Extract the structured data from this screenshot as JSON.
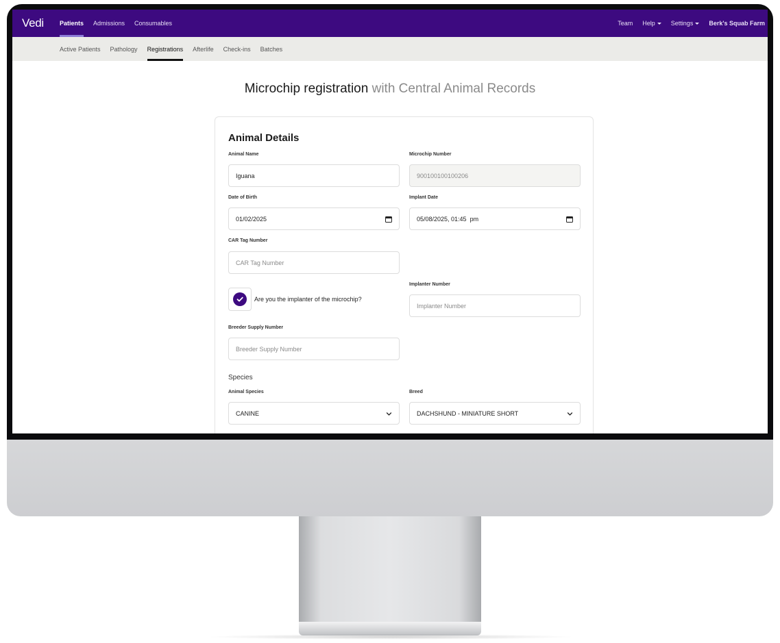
{
  "app": {
    "brand": "Vedi"
  },
  "topnav": {
    "items": [
      {
        "label": "Patients"
      },
      {
        "label": "Admissions"
      },
      {
        "label": "Consumables"
      }
    ],
    "right": [
      {
        "label": "Team"
      },
      {
        "label": "Help"
      },
      {
        "label": "Settings"
      }
    ],
    "farm": "Berk's Squab Farm"
  },
  "subnav": {
    "items": [
      {
        "label": "Active Patients"
      },
      {
        "label": "Pathology"
      },
      {
        "label": "Registrations"
      },
      {
        "label": "Afterlife"
      },
      {
        "label": "Check-ins"
      },
      {
        "label": "Batches"
      }
    ]
  },
  "page": {
    "title": "Microchip registration",
    "title_suffix": "with Central Animal Records"
  },
  "form": {
    "heading": "Animal Details",
    "animal_name": {
      "label": "Animal Name",
      "value": "Iguana"
    },
    "microchip": {
      "label": "Microchip Number",
      "value": "900100100100206"
    },
    "dob": {
      "label": "Date of Birth",
      "value": "01/02/2025"
    },
    "implant_date": {
      "label": "Implant Date",
      "value": "05/08/2025, 01:45  pm"
    },
    "car_tag": {
      "label": "CAR Tag Number",
      "placeholder": "CAR Tag Number"
    },
    "implanter_question": "Are you the implanter of the microchip?",
    "implanter_number": {
      "label": "Implanter Number",
      "placeholder": "Implanter Number"
    },
    "breeder": {
      "label": "Breeder Supply Number",
      "placeholder": "Breeder Supply Number"
    },
    "species_heading": "Species",
    "species": {
      "label": "Animal Species",
      "value": "CANINE"
    },
    "breed": {
      "label": "Breed",
      "value": "DACHSHUND - MINIATURE SHORT"
    }
  },
  "colors": {
    "brand": "#3d0a80",
    "subnav_bg": "#ebebe8"
  }
}
